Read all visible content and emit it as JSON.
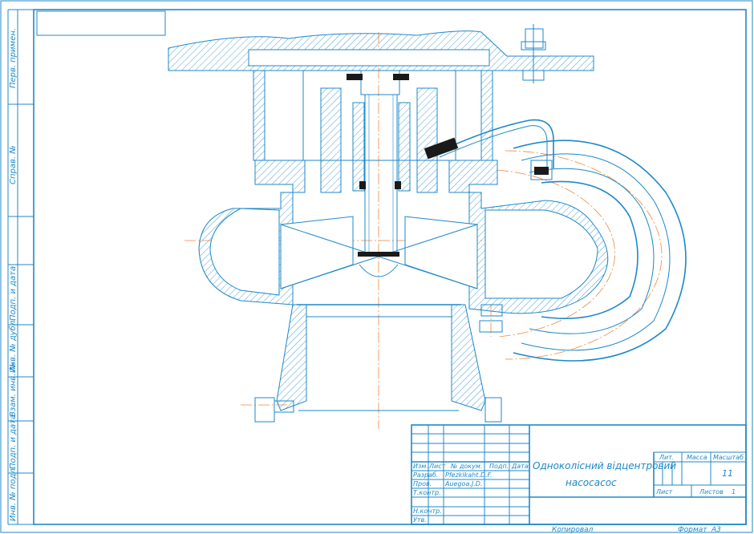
{
  "drawing": {
    "colors": {
      "line": "#1e88c8",
      "centerline": "#f0883c",
      "fill": "#1a1a1a"
    }
  },
  "side_labels": {
    "perv_primen": "Перв. примен.",
    "sprav": "Справ. №",
    "podp_data_1": "Подп. и дата",
    "inv_dubl": "Инв. № дубл.",
    "vzam_inv": "Взам. инв. №",
    "podp_data_2": "Подп. и дата",
    "inv_podl": "Инв. № подл."
  },
  "title_block": {
    "header": {
      "izm": "Изм.",
      "list": "Лист",
      "doc": "№ докум.",
      "podp": "Подп.",
      "data": "Дата"
    },
    "roles": {
      "razrab": "Разраб.",
      "prov": "Пров.",
      "tkontr": "Т.контр.",
      "nkontr": "Н.контр.",
      "utv": "Утв."
    },
    "names": {
      "razrab": "Pfezklkaht.D.F.",
      "prov": "Auegoa.J.D."
    },
    "title_line1": "Одноколісний відцентровий",
    "title_line2": "насосасос",
    "lit": "Лит.",
    "massa": "Масса",
    "masshtab": "Масштаб",
    "masshtab_value": "11",
    "list": "Лист",
    "listov": "Листов",
    "listov_value": "1",
    "kopiroval": "Копировал",
    "format": "Формат",
    "format_value": "А3"
  }
}
